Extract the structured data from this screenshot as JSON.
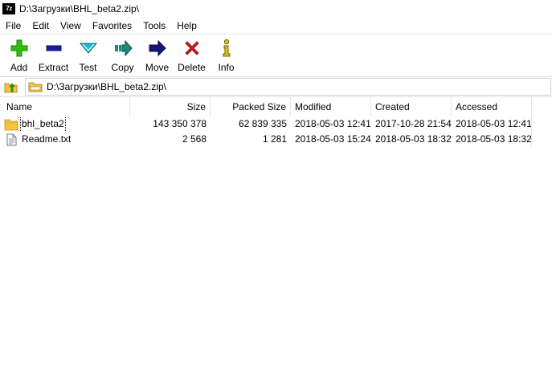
{
  "window": {
    "app_icon_text": "7z",
    "title": "D:\\Загрузки\\BHL_beta2.zip\\"
  },
  "menu": [
    "File",
    "Edit",
    "View",
    "Favorites",
    "Tools",
    "Help"
  ],
  "toolbar": {
    "add": "Add",
    "extract": "Extract",
    "test": "Test",
    "copy": "Copy",
    "move": "Move",
    "delete": "Delete",
    "info": "Info"
  },
  "address": {
    "path": "D:\\Загрузки\\BHL_beta2.zip\\"
  },
  "columns": {
    "name": "Name",
    "size": "Size",
    "packed_size": "Packed Size",
    "modified": "Modified",
    "created": "Created",
    "accessed": "Accessed"
  },
  "files": [
    {
      "name": "bhl_beta2",
      "icon": "folder-icon",
      "size": "143 350 378",
      "packed_size": "62 839 335",
      "modified": "2018-05-03 12:41",
      "created": "2017-10-28 21:54",
      "accessed": "2018-05-03 12:41"
    },
    {
      "name": "Readme.txt",
      "icon": "text-file-icon",
      "size": "2 568",
      "packed_size": "1 281",
      "modified": "2018-05-03 15:24",
      "created": "2018-05-03 18:32",
      "accessed": "2018-05-03 18:32"
    }
  ],
  "colors": {
    "add": "#2ec000",
    "extract": "#1a1aa6",
    "test": "#1fb6c8",
    "copy": "#1a8a7a",
    "move": "#16167a",
    "delete": "#d81818",
    "info": "#e0c800",
    "folder": "#f5c443"
  }
}
